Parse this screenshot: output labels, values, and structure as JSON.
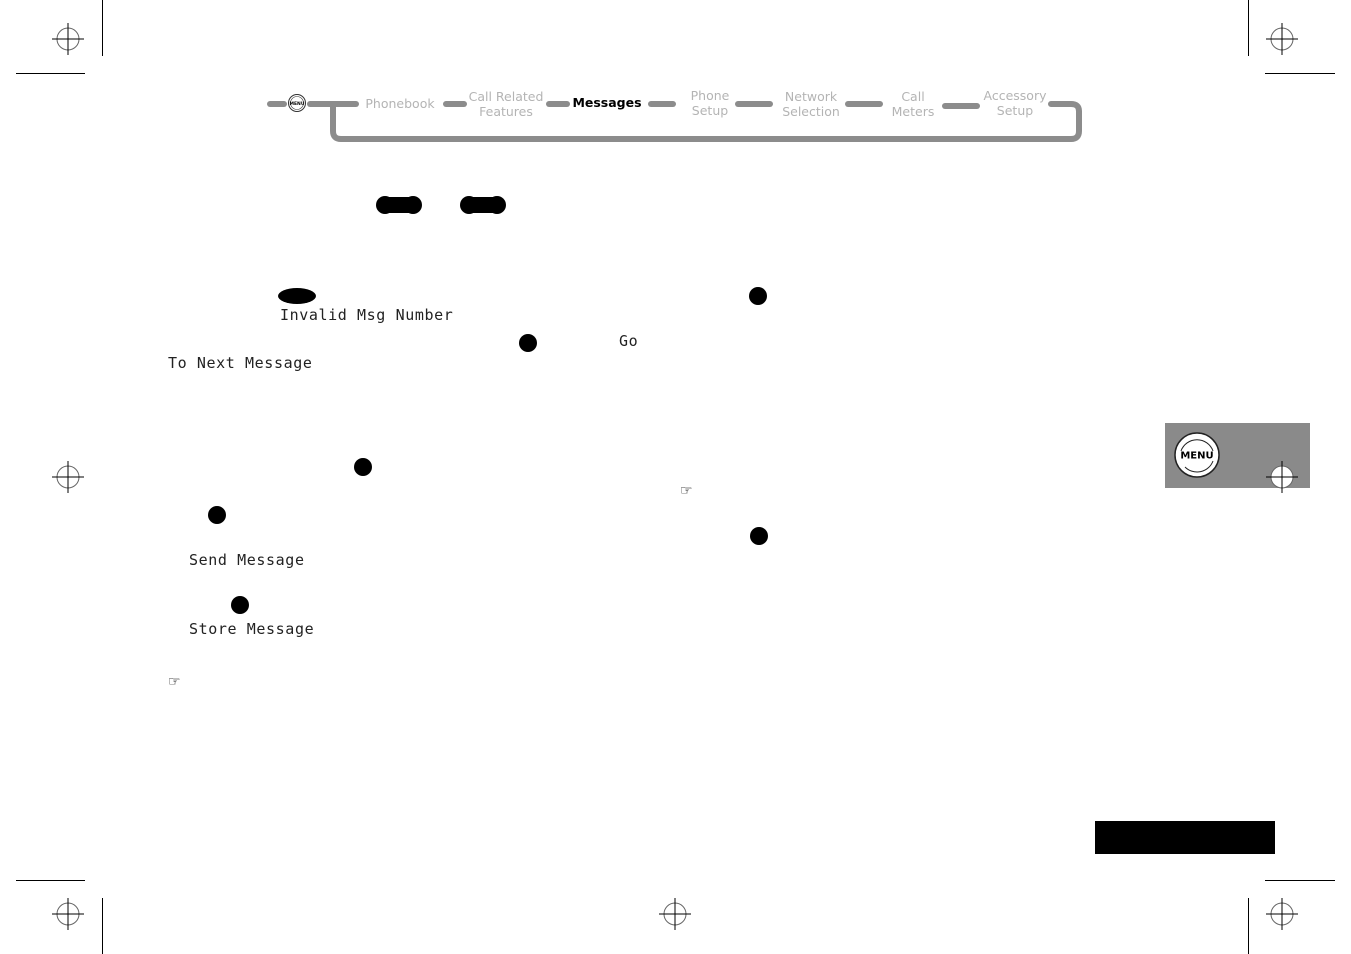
{
  "nav": {
    "menu_icon_label": "MENU",
    "items": [
      {
        "label": "Phonebook",
        "active": false
      },
      {
        "label": "Call Related\nFeatures",
        "active": false
      },
      {
        "label": "Messages",
        "active": true
      },
      {
        "label": "Phone\nSetup",
        "active": false
      },
      {
        "label": "Network\nSelection",
        "active": false
      },
      {
        "label": "Call\nMeters",
        "active": false
      },
      {
        "label": "Accessory\nSetup",
        "active": false
      }
    ]
  },
  "display": {
    "invalid_msg": "Invalid Msg Number",
    "go": "Go",
    "to_next": "To Next Message",
    "send": "Send Message",
    "store": "Store Message"
  },
  "side_tab": {
    "menu_label": "MENU",
    "background": "#8a8a8a"
  },
  "icons": {
    "note": "☞"
  },
  "colors": {
    "nav_inactive": "#b4b4b4",
    "nav_connector": "#8c8c8c",
    "ink": "#000000"
  }
}
